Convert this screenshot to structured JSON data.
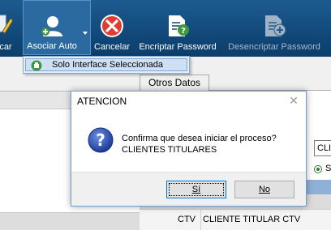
{
  "toolbar": {
    "edit_label": "ificar",
    "asociar_label": "Asociar Auto",
    "cancelar_label": "Cancelar",
    "encriptar_label": "Encriptar Password",
    "desencriptar_label": "Desencriptar Password",
    "icons": {
      "edit": "pencil-icon",
      "asociar": "user-add-icon",
      "cancelar": "cancel-icon",
      "encriptar": "document-question-icon",
      "desencriptar": "document-add-icon"
    }
  },
  "dropdown": {
    "items": [
      {
        "label": "Solo Interface Seleccionada",
        "icon": "interface-icon"
      }
    ]
  },
  "tabs": {
    "otros_datos": "Otros Datos"
  },
  "form": {
    "input_value": "CLIE",
    "radio_label": "S",
    "grid_columns": [
      "CTV",
      "CLIENTE TITULAR CTV"
    ]
  },
  "dialog": {
    "title": "ATENCION",
    "message_line1": "Confirma que desea iniciar el proceso?",
    "message_line2": "CLIENTES TITULARES",
    "yes_label": "Sí",
    "no_label": "No",
    "icon": "question-icon"
  },
  "colors": {
    "toolbar_bg": "#0f4676",
    "dialog_border": "#6f9fd0",
    "menu_highlight": "#cfe0f5"
  }
}
